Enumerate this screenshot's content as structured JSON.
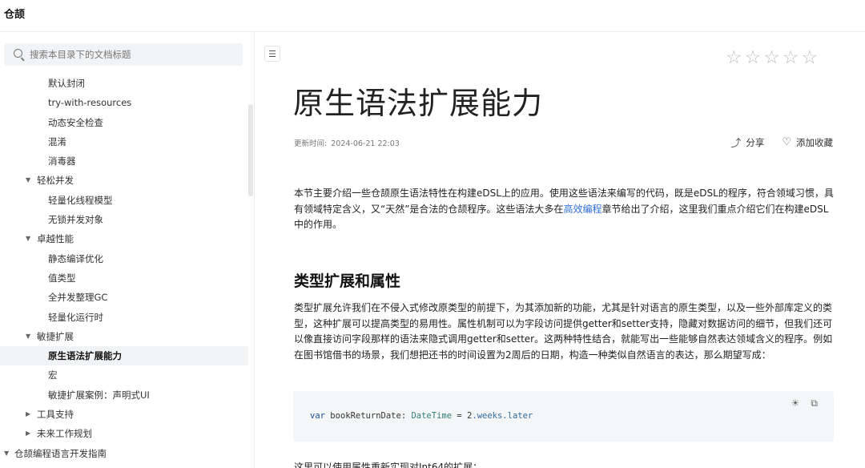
{
  "header": {
    "brand": "仓颉"
  },
  "sidebar": {
    "search_placeholder": "搜索本目录下的文档标题",
    "items": [
      {
        "label": "默认封闭",
        "level": 3
      },
      {
        "label": "try-with-resources",
        "level": 3
      },
      {
        "label": "动态安全检查",
        "level": 3
      },
      {
        "label": "混淆",
        "level": 3
      },
      {
        "label": "消毒器",
        "level": 3
      },
      {
        "label": "轻松并发",
        "level": 2,
        "caret": "▼"
      },
      {
        "label": "轻量化线程模型",
        "level": 3
      },
      {
        "label": "无锁并发对象",
        "level": 3
      },
      {
        "label": "卓越性能",
        "level": 2,
        "caret": "▼"
      },
      {
        "label": "静态编译优化",
        "level": 3
      },
      {
        "label": "值类型",
        "level": 3
      },
      {
        "label": "全并发整理GC",
        "level": 3
      },
      {
        "label": "轻量化运行时",
        "level": 3
      },
      {
        "label": "敏捷扩展",
        "level": 2,
        "caret": "▼"
      },
      {
        "label": "原生语法扩展能力",
        "level": 3,
        "active": true
      },
      {
        "label": "宏",
        "level": 3
      },
      {
        "label": "敏捷扩展案例：声明式UI",
        "level": 3
      },
      {
        "label": "工具支持",
        "level": 2,
        "caret": "▶"
      },
      {
        "label": "未来工作规划",
        "level": 2,
        "caret": "▶"
      },
      {
        "label": "仓颉编程语言开发指南",
        "level": 1,
        "caret": "▼"
      }
    ]
  },
  "article": {
    "title": "原生语法扩展能力",
    "updated_label": "更新时间:",
    "updated_value": "2024-06-21 22:03",
    "share_label": "分享",
    "favorite_label": "添加收藏",
    "intro_part1": "本节主要介绍一些仓颉原生语法特性在构建eDSL上的应用。使用这些语法来编写的代码，既是eDSL的程序，符合领域习惯，具有领域特定含义，又“天然”是合法的仓颉程序。这些语法大多在",
    "intro_link": "高效编程",
    "intro_part2": "章节给出了介绍，这里我们重点介绍它们在构建eDSL中的作用。",
    "section_heading": "类型扩展和属性",
    "section_body": "类型扩展允许我们在不侵入式修改原类型的前提下，为其添加新的功能，尤其是针对语言的原生类型，以及一些外部库定义的类型，这种扩展可以提高类型的易用性。属性机制可以为字段访问提供getter和setter支持，隐藏对数据访问的细节，但我们还可以像直接访问字段那样的语法来隐式调用getter和setter。这两种特性结合，就能写出一些能够自然表达领域含义的程序。例如在图书馆借书的场景，我们想把还书的时间设置为2周后的日期，构造一种类似自然语言的表达，那么期望写成：",
    "code": {
      "kw": "var",
      "name": "bookReturnDate",
      "colon": ":",
      "type": "DateTime",
      "eq": "=",
      "num": "2",
      "prop1": "weeks",
      "prop2": "later"
    },
    "next_para": "这里可以使用属性重新实现对Int64的扩展："
  },
  "icons": {
    "search": "search-icon",
    "toc": "toc-toggle-icon",
    "star": "star-icon",
    "share": "share-icon",
    "favorite": "heart-icon",
    "theme": "sun-icon",
    "copy": "copy-icon"
  },
  "rating": {
    "max": 5,
    "value": 0
  }
}
